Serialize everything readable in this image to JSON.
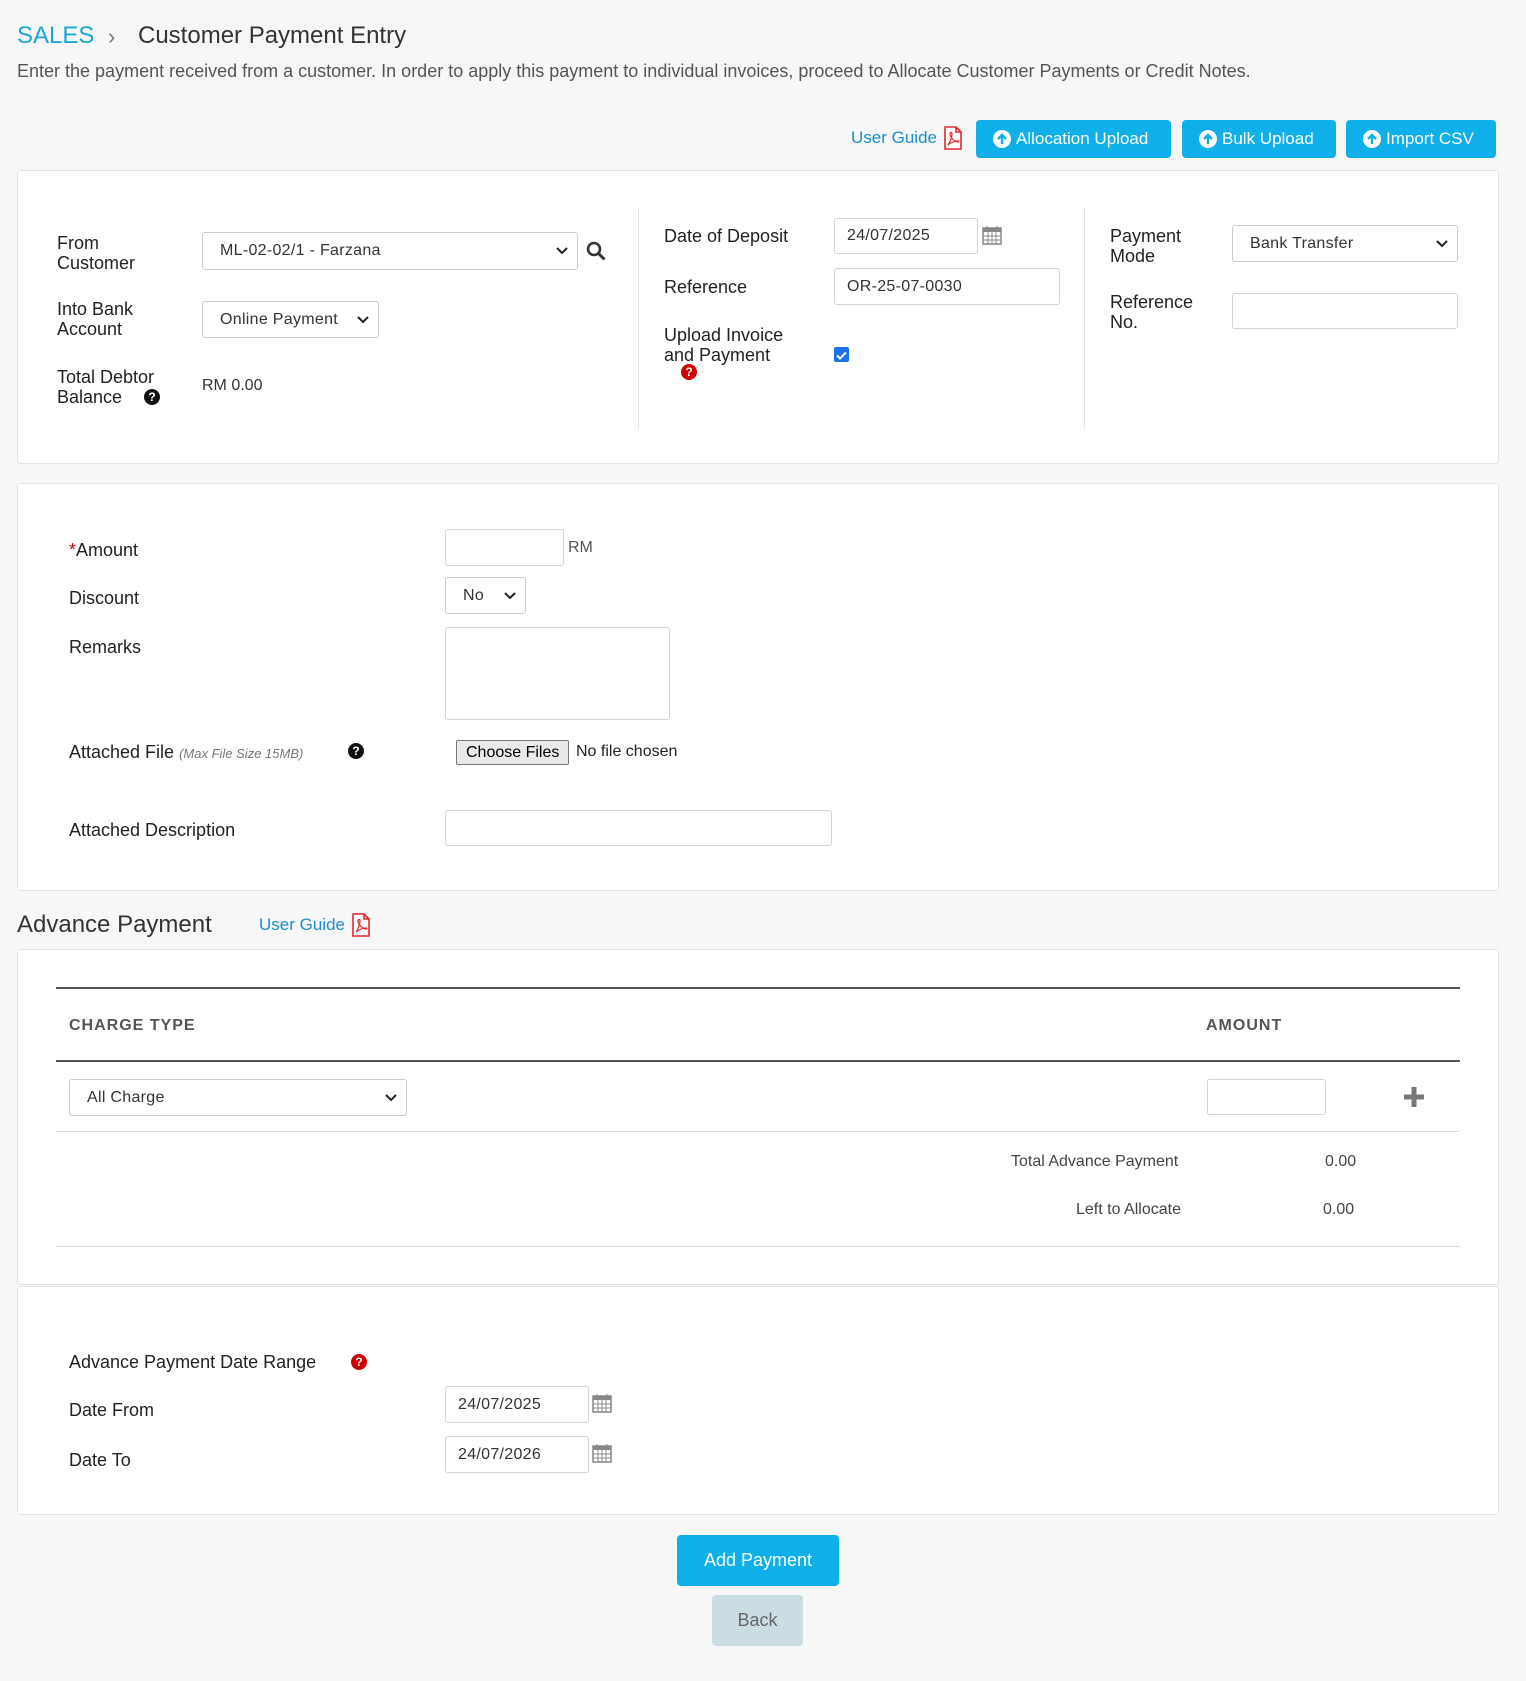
{
  "breadcrumb": {
    "root": "SALES",
    "separator": "›",
    "title": "Customer Payment Entry"
  },
  "subtitle": "Enter the payment received from a customer. In order to apply this payment to individual invoices, proceed to Allocate Customer Payments or Credit Notes.",
  "toolbar": {
    "user_guide": "User Guide",
    "allocation_upload": "Allocation Upload",
    "bulk_upload": "Bulk Upload",
    "import_csv": "Import CSV"
  },
  "header_form": {
    "from_customer_label_1": "From",
    "from_customer_label_2": "Customer",
    "from_customer_value": "ML-02-02/1 - Farzana",
    "into_bank_label_1": "Into Bank",
    "into_bank_label_2": "Account",
    "into_bank_value": "Online Payment",
    "total_debtor_label_1": "Total Debtor",
    "total_debtor_label_2": "Balance",
    "total_debtor_value": "RM 0.00",
    "date_of_deposit_label": "Date of Deposit",
    "date_of_deposit_value": "24/07/2025",
    "reference_label": "Reference",
    "reference_value": "OR-25-07-0030",
    "upload_invoice_label_1": "Upload Invoice",
    "upload_invoice_label_2": "and Payment",
    "upload_invoice_checked": true,
    "payment_mode_label_1": "Payment",
    "payment_mode_label_2": "Mode",
    "payment_mode_value": "Bank Transfer",
    "reference_no_label_1": "Reference",
    "reference_no_label_2": "No.",
    "reference_no_value": ""
  },
  "payment_form": {
    "amount_required_mark": "*",
    "amount_label": "Amount",
    "amount_value": "",
    "amount_unit": "RM",
    "discount_label": "Discount",
    "discount_value": "No",
    "remarks_label": "Remarks",
    "remarks_value": "",
    "attached_file_label": "Attached File",
    "attached_file_hint": "(Max File Size 15MB)",
    "choose_files_label": "Choose Files",
    "no_file_text": "No file chosen",
    "attached_description_label": "Attached Description",
    "attached_description_value": ""
  },
  "advance_payment": {
    "title": "Advance Payment",
    "user_guide": "User Guide",
    "col_charge_type": "CHARGE TYPE",
    "col_amount": "AMOUNT",
    "charge_type_value": "All Charge",
    "amount_value": "",
    "total_label": "Total Advance Payment",
    "total_value": "0.00",
    "left_label": "Left to Allocate",
    "left_value": "0.00"
  },
  "date_range": {
    "label": "Advance Payment Date Range",
    "date_from_label": "Date From",
    "date_from_value": "24/07/2025",
    "date_to_label": "Date To",
    "date_to_value": "24/07/2026"
  },
  "actions": {
    "add_payment": "Add Payment",
    "back": "Back"
  },
  "colors": {
    "accent": "#0fb0ea",
    "link": "#1a8fc9",
    "required": "#d00000",
    "back_button": "#c9dde3"
  }
}
